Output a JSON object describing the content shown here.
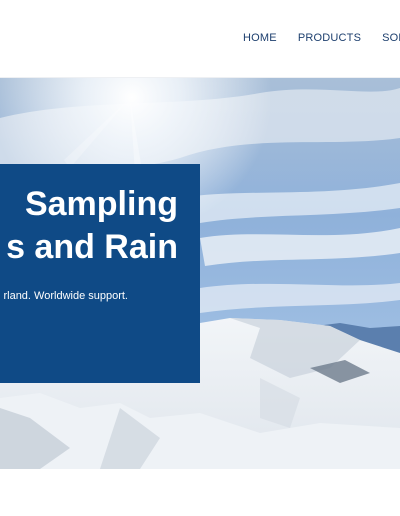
{
  "nav": {
    "items": [
      "HOME",
      "PRODUCTS",
      "SOLUTI"
    ]
  },
  "hero": {
    "title_line1": "Sampling",
    "title_line2": "s and Rain",
    "subtitle": "rland. Worldwide support."
  },
  "colors": {
    "brand_blue": "#0f4a86",
    "nav_text": "#1d3f6e"
  }
}
